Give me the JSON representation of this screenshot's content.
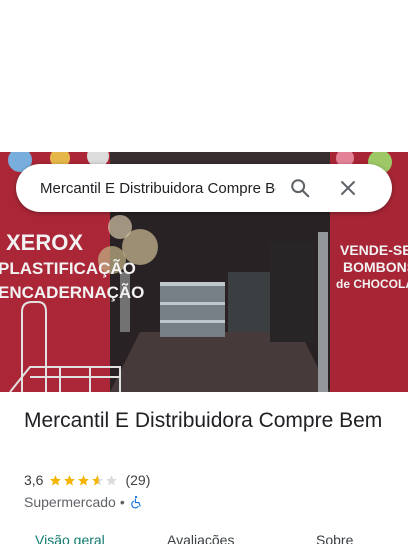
{
  "search": {
    "query": "Mercantil E Distribuidora Compre Bem",
    "search_icon": "search-icon",
    "close_icon": "close-icon"
  },
  "hero": {
    "photo": "storefront-photo",
    "sign_left": [
      "XEROX",
      "PLASTIFICAÇÃO",
      "ENCADERNAÇÃO"
    ],
    "sign_right": [
      "VENDE-SE",
      "BOMBONS",
      "de CHOCOLATE"
    ]
  },
  "place": {
    "name": "Mercantil E Distribuidora Compre Bem",
    "rating": "3,6",
    "stars_filled": 3.6,
    "review_count": "(29)",
    "category": "Supermercado",
    "separator": "•",
    "accessibility_icon": "wheelchair-icon"
  },
  "tabs": [
    {
      "label": "Visão geral",
      "active": true
    },
    {
      "label": "Avaliações",
      "active": false
    },
    {
      "label": "Sobre",
      "active": false
    }
  ],
  "colors": {
    "star": "#f5b400",
    "star_empty": "#dadce0",
    "accent_tab": "#137b6f",
    "wall_red": "#b52a3a",
    "accessibility": "#1a73e8"
  }
}
